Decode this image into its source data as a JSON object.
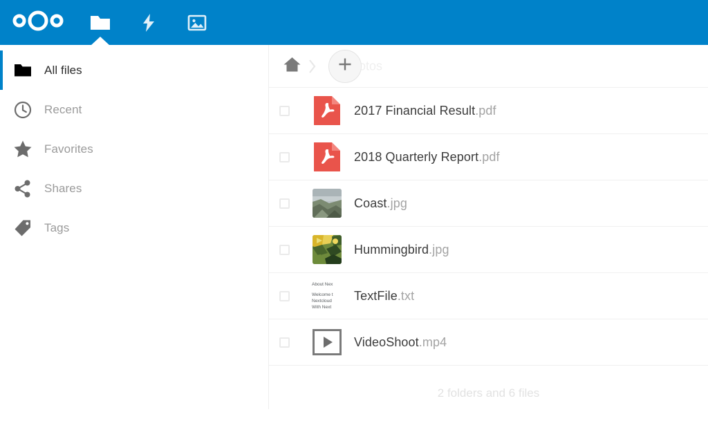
{
  "header": {
    "logo_name": "nextcloud-logo",
    "brand_color": "#0082c9",
    "nav": [
      {
        "label": "Files",
        "icon": "folder-icon",
        "active": true
      },
      {
        "label": "Activity",
        "icon": "lightning-bolt-icon",
        "active": false
      },
      {
        "label": "Photos",
        "icon": "image-icon",
        "active": false
      }
    ]
  },
  "sidebar": {
    "items": [
      {
        "label": "All files",
        "icon": "folder-icon",
        "active": true
      },
      {
        "label": "Recent",
        "icon": "clock-icon",
        "active": false
      },
      {
        "label": "Favorites",
        "icon": "star-icon",
        "active": false
      },
      {
        "label": "Shares",
        "icon": "share-icon",
        "active": false
      },
      {
        "label": "Tags",
        "icon": "tag-icon",
        "active": false
      }
    ]
  },
  "breadcrumb": {
    "home_icon": "home-icon",
    "separator": "chevron-right-icon",
    "current_folder": "Photos",
    "new_button_label": "+"
  },
  "files": [
    {
      "name": "2017 Financial Result",
      "ext": ".pdf",
      "type": "pdf",
      "checked": false
    },
    {
      "name": "2018 Quarterly Report",
      "ext": ".pdf",
      "type": "pdf",
      "checked": false
    },
    {
      "name": "Coast",
      "ext": ".jpg",
      "type": "image-coast",
      "checked": false
    },
    {
      "name": "Hummingbird",
      "ext": ".jpg",
      "type": "image-hummingbird",
      "checked": false
    },
    {
      "name": "TextFile",
      "ext": ".txt",
      "type": "text",
      "checked": false
    },
    {
      "name": "VideoShoot",
      "ext": ".mp4",
      "type": "video",
      "checked": false
    }
  ],
  "text_preview": {
    "lines": [
      "About Nex",
      "Welcome t",
      "Nextcloud",
      "With Next"
    ]
  },
  "summary": {
    "text": "2 folders and 6 files"
  },
  "colors": {
    "brand": "#0082c9",
    "pdf_red": "#e9544b",
    "text_primary": "#3b3b3b",
    "text_muted": "#9a9a9a",
    "extension_gray": "#a3a3a3",
    "summary_gray": "#e2e2e2"
  }
}
